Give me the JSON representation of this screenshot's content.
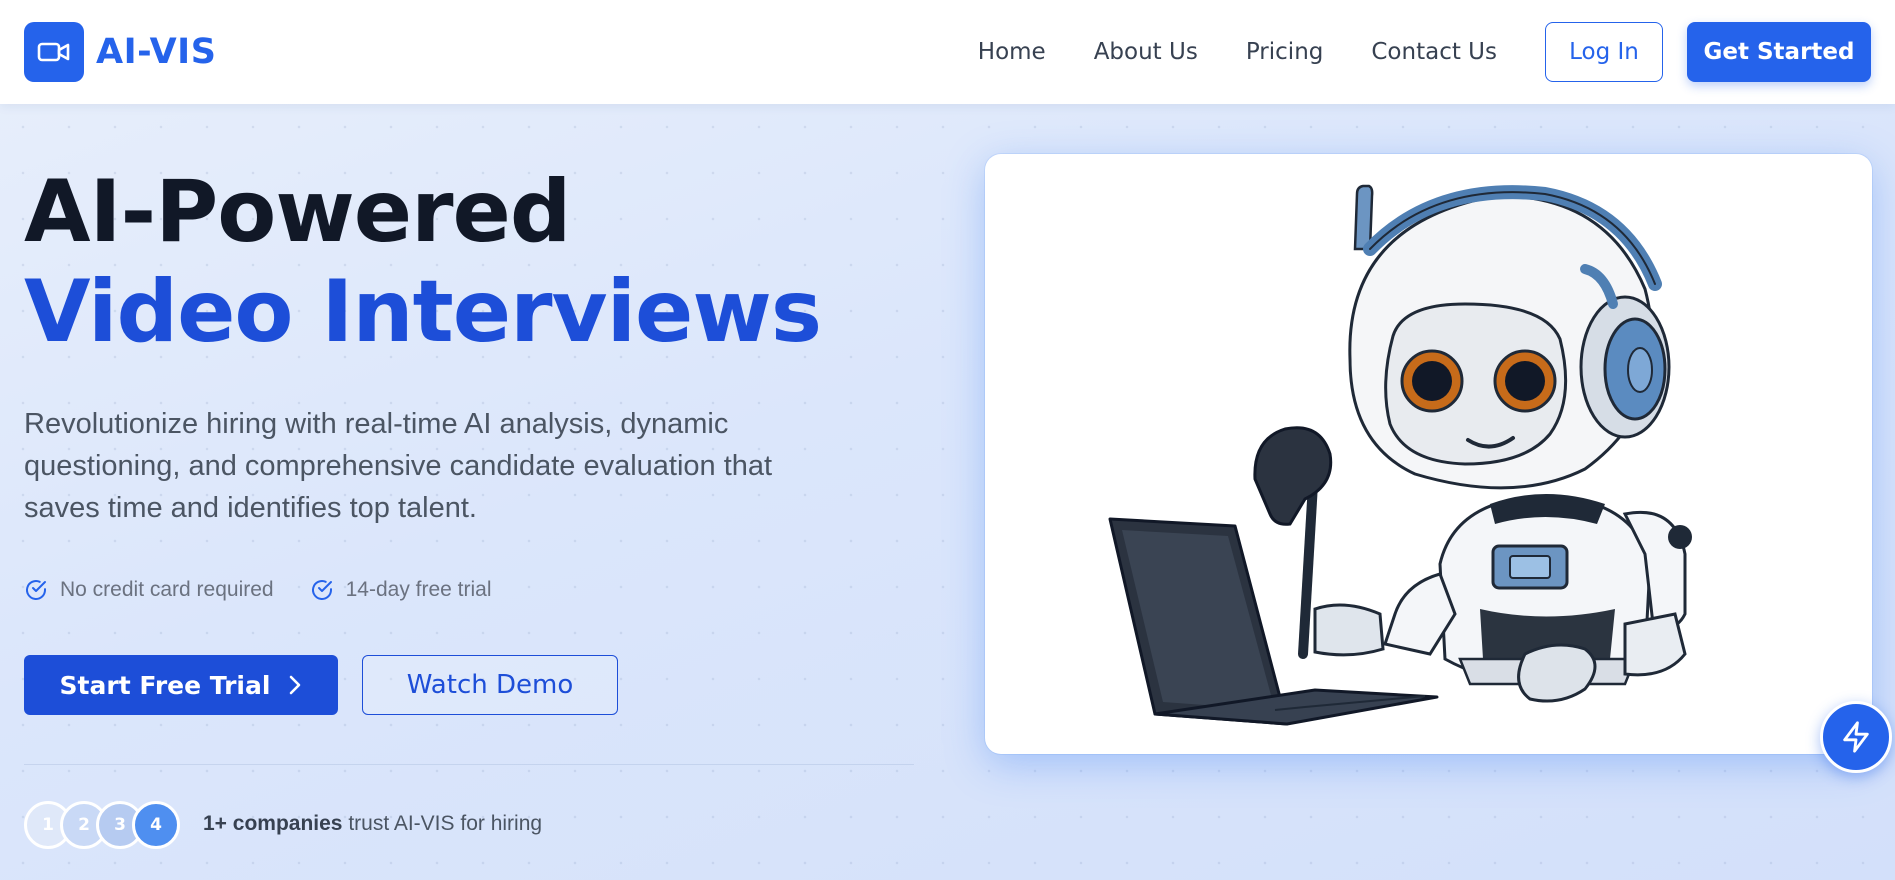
{
  "brand": {
    "name": "AI-VIS",
    "accent": "#2563eb",
    "logo_icon": "video-camera-icon"
  },
  "nav": {
    "links": [
      "Home",
      "About Us",
      "Pricing",
      "Contact Us"
    ],
    "login_label": "Log In",
    "get_started_label": "Get Started"
  },
  "hero": {
    "title_line1": "AI-Powered",
    "title_line2": "Video Interviews",
    "description": "Revolutionize hiring with real-time AI analysis, dynamic questioning, and comprehensive candidate evaluation that saves time and identifies top talent.",
    "checks": [
      "No credit card required",
      "14-day free trial"
    ],
    "primary_cta": "Start Free Trial",
    "secondary_cta": "Watch Demo",
    "avatars": [
      "1",
      "2",
      "3",
      "4"
    ],
    "trust_count": "1+ companies",
    "trust_rest": " trust AI-VIS for hiring"
  },
  "illustration": {
    "subject": "robot-interviewer-illustration",
    "fab_icon": "lightning-icon"
  }
}
